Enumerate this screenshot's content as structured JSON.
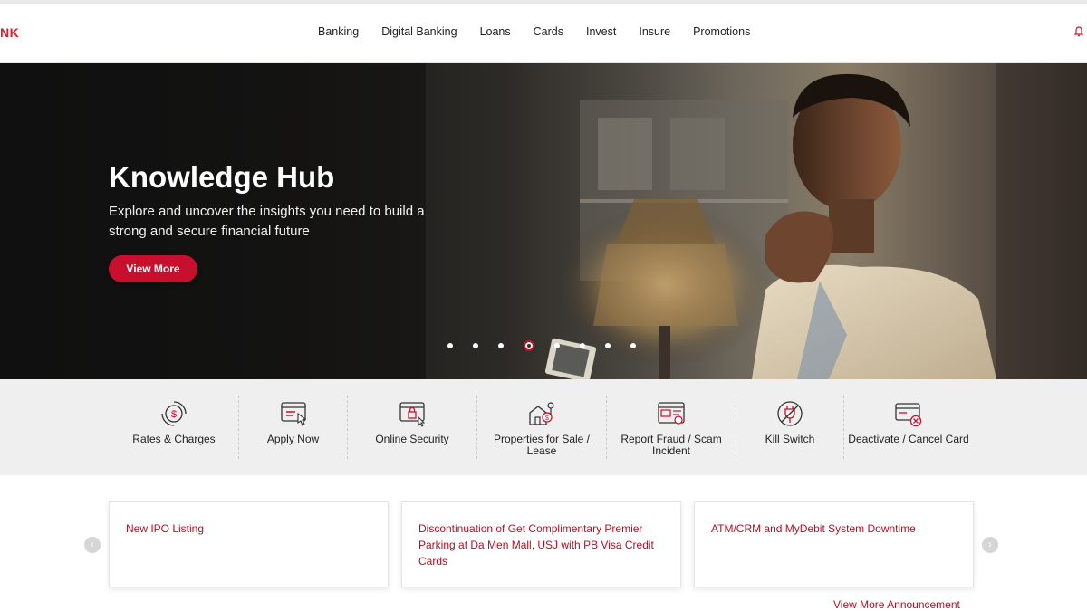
{
  "brand": {
    "logo_text": "NK",
    "accent": "#c8102e"
  },
  "nav": {
    "items": [
      "Banking",
      "Digital Banking",
      "Loans",
      "Cards",
      "Invest",
      "Insure",
      "Promotions"
    ]
  },
  "hero": {
    "title": "Knowledge Hub",
    "subtitle": "Explore and uncover the insights you need to build a strong and secure financial future",
    "button": "View More",
    "slides_total": 8,
    "active_slide": 4
  },
  "quick_links": [
    {
      "label": "Rates & Charges",
      "icon": "rates-icon"
    },
    {
      "label": "Apply Now",
      "icon": "apply-icon"
    },
    {
      "label": "Online Security",
      "icon": "security-icon"
    },
    {
      "label": "Properties for Sale / Lease",
      "icon": "property-icon"
    },
    {
      "label": "Report Fraud / Scam Incident",
      "icon": "fraud-icon"
    },
    {
      "label": "Kill Switch",
      "icon": "kill-switch-icon"
    },
    {
      "label": "Deactivate / Cancel Card",
      "icon": "card-cancel-icon"
    }
  ],
  "announcements": {
    "items": [
      "New IPO Listing",
      "Discontinuation of Get Complimentary Premier Parking at Da Men Mall, USJ with PB Visa Credit Cards",
      "ATM/CRM and MyDebit System Downtime"
    ],
    "view_more": "View More Announcement"
  }
}
